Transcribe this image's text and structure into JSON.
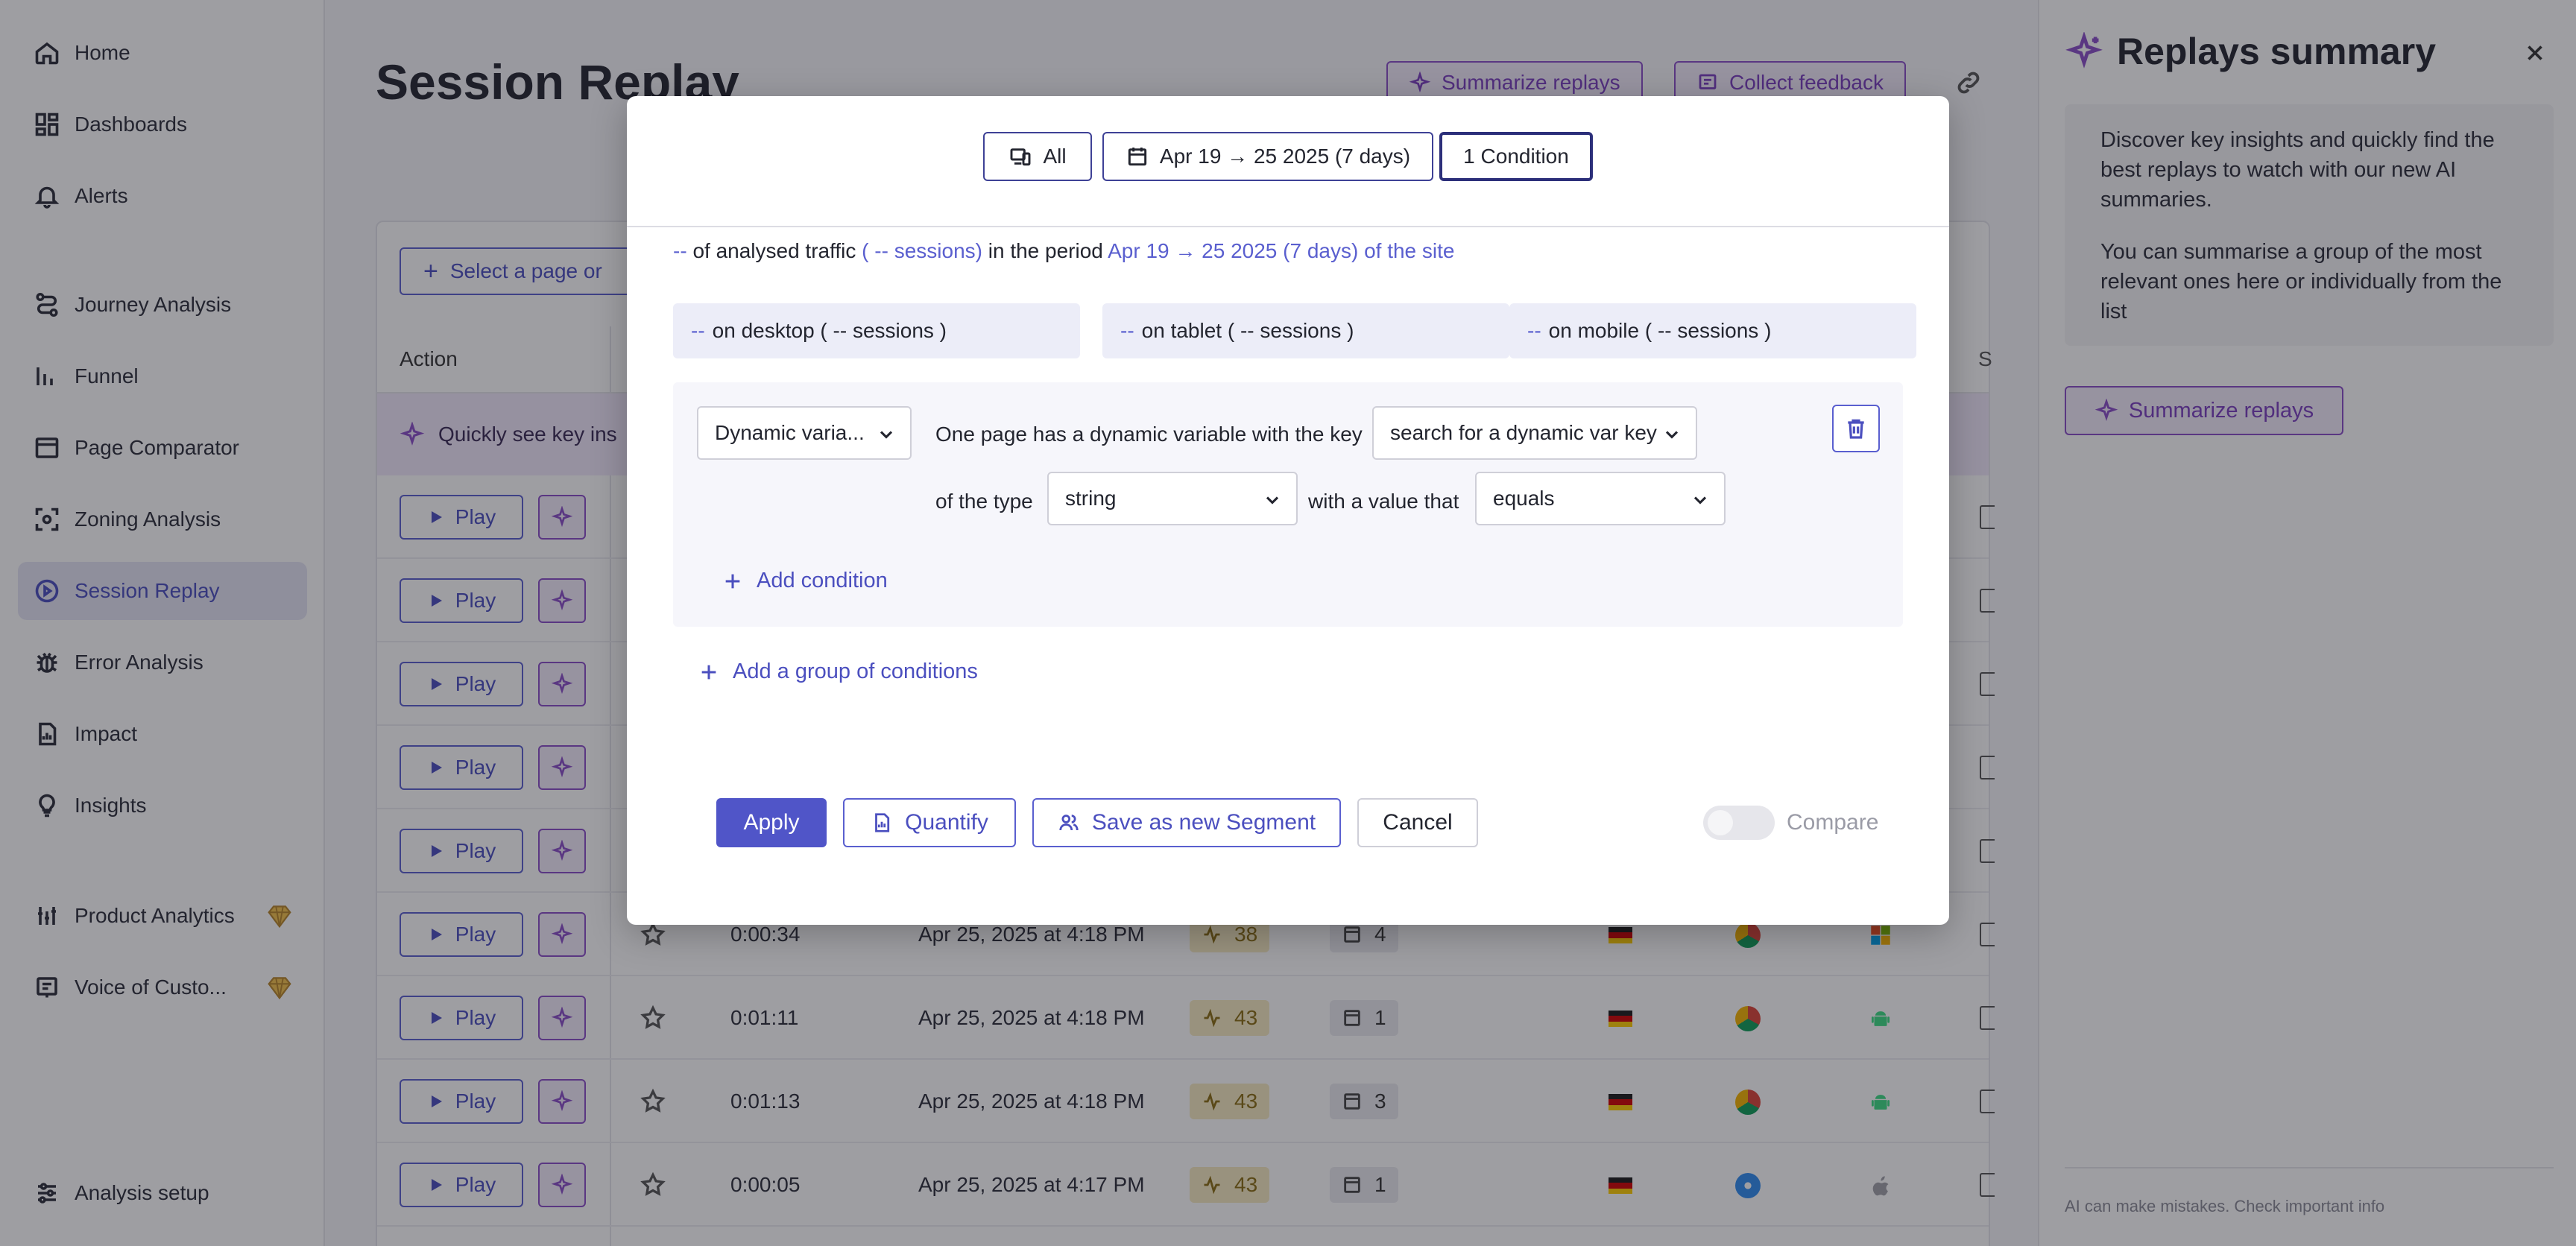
{
  "sidebar": {
    "items": [
      {
        "label": "Home",
        "icon": "home-icon"
      },
      {
        "label": "Dashboards",
        "icon": "dashboard-icon"
      },
      {
        "label": "Alerts",
        "icon": "bell-icon"
      },
      {
        "label": "Journey Analysis",
        "icon": "journey-icon"
      },
      {
        "label": "Funnel",
        "icon": "funnel-icon"
      },
      {
        "label": "Page Comparator",
        "icon": "page-comparator-icon"
      },
      {
        "label": "Zoning Analysis",
        "icon": "zoning-icon"
      },
      {
        "label": "Session Replay",
        "icon": "play-circle-icon",
        "active": true
      },
      {
        "label": "Error Analysis",
        "icon": "bug-icon"
      },
      {
        "label": "Impact",
        "icon": "impact-icon"
      },
      {
        "label": "Insights",
        "icon": "lightbulb-icon"
      },
      {
        "label": "Product Analytics",
        "icon": "product-analytics-icon",
        "premium": true
      },
      {
        "label": "Voice of Custo...",
        "icon": "voice-icon",
        "premium": true
      },
      {
        "label": "Analysis setup",
        "icon": "sliders-icon"
      }
    ]
  },
  "main": {
    "title": "Session Replay",
    "summarize_label": "Summarize replays",
    "feedback_label": "Collect feedback",
    "select_page_label": "Select a page or",
    "col_action": "Action",
    "col_s": "S",
    "ai_banner": "Quickly see key ins",
    "play_label": "Play",
    "rows": [
      {
        "duration": "0:00:34",
        "date": "Apr 25, 2025 at 4:18 PM",
        "score": "38",
        "pages": "4",
        "browser": "chrome",
        "os": "windows"
      },
      {
        "duration": "0:01:11",
        "date": "Apr 25, 2025 at 4:18 PM",
        "score": "43",
        "pages": "1",
        "browser": "chrome",
        "os": "android"
      },
      {
        "duration": "0:01:13",
        "date": "Apr 25, 2025 at 4:18 PM",
        "score": "43",
        "pages": "3",
        "browser": "chrome",
        "os": "android"
      },
      {
        "duration": "0:00:05",
        "date": "Apr 25, 2025 at 4:17 PM",
        "score": "43",
        "pages": "1",
        "browser": "safari",
        "os": "apple"
      }
    ]
  },
  "panel": {
    "title": "Replays summary",
    "info_1": "Discover key insights and quickly find the best replays to watch with our new AI summaries.",
    "info_2": "You can summarise a group of the most relevant ones here or individually from the list",
    "button_label": "Summarize replays",
    "footer": "AI can make mistakes. Check important info"
  },
  "modal": {
    "chip_all": "All",
    "chip_date": "Apr 19 → 25 2025 (7 days)",
    "chip_condition": "1 Condition",
    "traffic": {
      "dash": "--",
      "text_1": "of analysed traffic",
      "sessions": "( -- sessions)",
      "text_2": "in the period",
      "period": "Apr 19 → 25 2025 (7 days) of the site"
    },
    "devices": [
      {
        "dash": "--",
        "label": "on desktop ( -- sessions )"
      },
      {
        "dash": "--",
        "label": "on tablet ( -- sessions )"
      },
      {
        "dash": "--",
        "label": "on mobile ( -- sessions )"
      }
    ],
    "condition": {
      "type_select": "Dynamic varia...",
      "text_key": "One page has a dynamic variable with the key",
      "key_select": "search for a dynamic var key",
      "text_type": "of the type",
      "value_type": "string",
      "text_value": "with a value that",
      "operator": "equals",
      "add_condition": "Add condition"
    },
    "add_group": "Add a group of conditions",
    "apply_label": "Apply",
    "quantify_label": "Quantify",
    "save_segment_label": "Save as new Segment",
    "cancel_label": "Cancel",
    "compare_label": "Compare",
    "compare_on": false
  },
  "colors": {
    "accent": "#5055c8",
    "ai_purple": "#8b4fc9",
    "active_nav_bg": "#e6e6f5",
    "score_bg": "#f7eac2"
  }
}
